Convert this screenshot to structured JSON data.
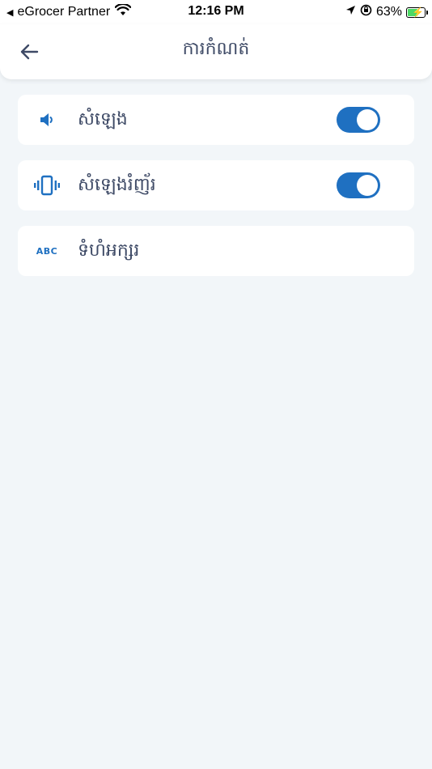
{
  "status_bar": {
    "carrier": "eGrocer Partner",
    "time": "12:16 PM",
    "battery": "63%",
    "battery_level": 0.63
  },
  "header": {
    "title": "ការកំណត់"
  },
  "settings": {
    "items": [
      {
        "label": "សំឡេង",
        "icon": "speaker-icon",
        "toggle_on": true
      },
      {
        "label": "សំឡេងរំញ័រ",
        "icon": "vibrate-icon",
        "toggle_on": true
      },
      {
        "label": "ទំហំអក្សរ",
        "icon": "abc-icon",
        "icon_text": "ABC"
      }
    ]
  },
  "colors": {
    "accent": "#1f70c1",
    "background": "#f2f6f9",
    "text": "#3e4a66"
  }
}
